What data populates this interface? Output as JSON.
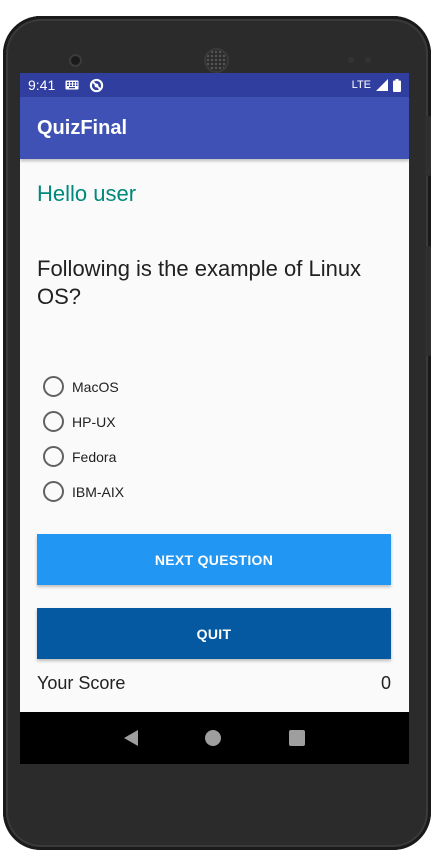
{
  "status_bar": {
    "time": "9:41",
    "network": "LTE",
    "icons": [
      "keyboard-icon",
      "sync-icon",
      "signal-icon",
      "battery-icon"
    ]
  },
  "app_bar": {
    "title": "QuizFinal"
  },
  "greeting": "Hello user",
  "question": "Following is the example of Linux OS?",
  "options": [
    {
      "label": "MacOS",
      "selected": false
    },
    {
      "label": "HP-UX",
      "selected": false
    },
    {
      "label": "Fedora",
      "selected": false
    },
    {
      "label": "IBM-AIX",
      "selected": false
    }
  ],
  "buttons": {
    "next": "NEXT QUESTION",
    "quit": "QUIT"
  },
  "score": {
    "label": "Your Score",
    "value": "0"
  },
  "colors": {
    "status_bar": "#303f9f",
    "app_bar": "#3f51b5",
    "greeting": "#00897b",
    "next_button": "#2196f3",
    "quit_button": "#0459a0"
  },
  "nav_bar": {
    "icons": [
      "back-icon",
      "home-icon",
      "recents-icon"
    ]
  }
}
